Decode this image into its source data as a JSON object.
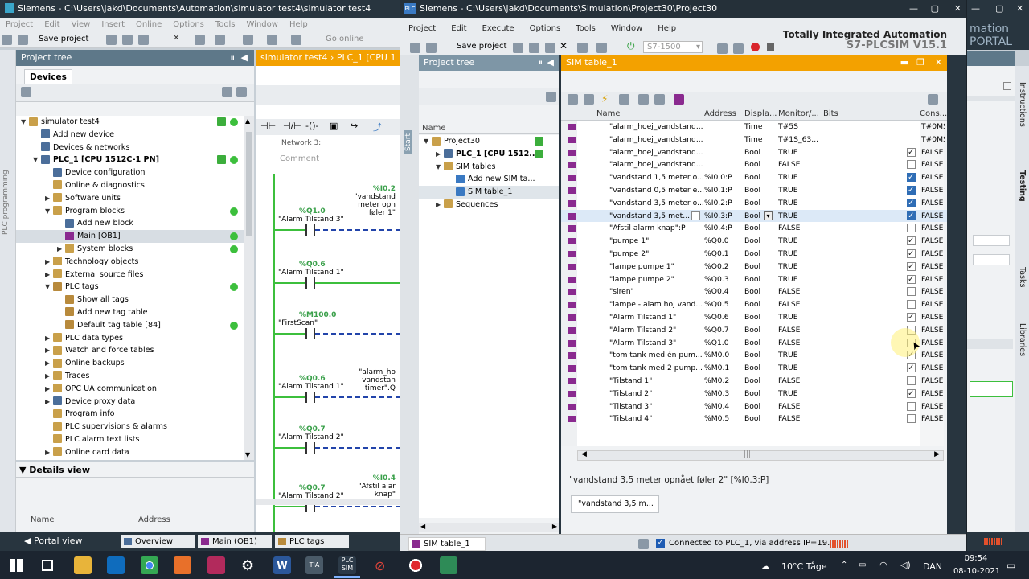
{
  "portal": {
    "title": "Siemens  -  C:\\Users\\jakd\\Documents\\Automation\\simulator test4\\simulator test4",
    "menu": [
      "Project",
      "Edit",
      "View",
      "Insert",
      "Online",
      "Options",
      "Tools",
      "Window",
      "Help"
    ],
    "save_label": "Save project",
    "go_online": "Go online",
    "right_brand": "mation",
    "right_brand2": "PORTAL",
    "project_tree_title": "Project tree",
    "devices_tab": "Devices",
    "side_label": "PLC programming",
    "tree": [
      {
        "label": "simulator test4",
        "indent": 0,
        "arrow": "▼"
      },
      {
        "label": "Add new device",
        "indent": 1,
        "arrow": ""
      },
      {
        "label": "Devices & networks",
        "indent": 1,
        "arrow": ""
      },
      {
        "label": "PLC_1 [CPU 1512C-1 PN]",
        "indent": 1,
        "arrow": "▼",
        "bold": true
      },
      {
        "label": "Device configuration",
        "indent": 2,
        "arrow": ""
      },
      {
        "label": "Online & diagnostics",
        "indent": 2,
        "arrow": ""
      },
      {
        "label": "Software units",
        "indent": 2,
        "arrow": "▶"
      },
      {
        "label": "Program blocks",
        "indent": 2,
        "arrow": "▼"
      },
      {
        "label": "Add new block",
        "indent": 3,
        "arrow": ""
      },
      {
        "label": "Main [OB1]",
        "indent": 3,
        "arrow": "",
        "selected": true
      },
      {
        "label": "System blocks",
        "indent": 3,
        "arrow": "▶"
      },
      {
        "label": "Technology objects",
        "indent": 2,
        "arrow": "▶"
      },
      {
        "label": "External source files",
        "indent": 2,
        "arrow": "▶"
      },
      {
        "label": "PLC tags",
        "indent": 2,
        "arrow": "▼"
      },
      {
        "label": "Show all tags",
        "indent": 3,
        "arrow": ""
      },
      {
        "label": "Add new tag table",
        "indent": 3,
        "arrow": ""
      },
      {
        "label": "Default tag table [84]",
        "indent": 3,
        "arrow": ""
      },
      {
        "label": "PLC data types",
        "indent": 2,
        "arrow": "▶"
      },
      {
        "label": "Watch and force tables",
        "indent": 2,
        "arrow": "▶"
      },
      {
        "label": "Online backups",
        "indent": 2,
        "arrow": "▶"
      },
      {
        "label": "Traces",
        "indent": 2,
        "arrow": "▶"
      },
      {
        "label": "OPC UA communication",
        "indent": 2,
        "arrow": "▶"
      },
      {
        "label": "Device proxy data",
        "indent": 2,
        "arrow": "▶"
      },
      {
        "label": "Program info",
        "indent": 2,
        "arrow": ""
      },
      {
        "label": "PLC supervisions & alarms",
        "indent": 2,
        "arrow": ""
      },
      {
        "label": "PLC alarm text lists",
        "indent": 2,
        "arrow": ""
      },
      {
        "label": "Online card data",
        "indent": 2,
        "arrow": "▶"
      }
    ],
    "details_view": "Details view",
    "details_cols": [
      "Name",
      "Address"
    ],
    "editor_tab": "simulator test4  ›  PLC_1 [CPU 1",
    "network_label": "Network 3:",
    "comment_label": "Comment",
    "ladder": [
      {
        "addr": "%Q1.0",
        "name": "\"Alarm Tilstand 3\""
      },
      {
        "addr": "%Q0.6",
        "name": "\"Alarm Tilstand 1\""
      },
      {
        "addr": "%M100.0",
        "name": "\"FirstScan\""
      },
      {
        "addr": "%Q0.6",
        "name": "\"Alarm Tilstand 1\""
      },
      {
        "addr": "%Q0.7",
        "name": "\"Alarm Tilstand 2\""
      },
      {
        "addr": "%Q0.7",
        "name": "\"Alarm Tilstand 2\""
      }
    ],
    "ladder_right": [
      {
        "addr": "%I0.2",
        "l1": "\"vandstand",
        "l2": "meter opn",
        "l3": "føler 1\""
      },
      {
        "addr": "",
        "l1": "\"alarm_ho",
        "l2": "vandstan",
        "l3": "timer\".Q"
      },
      {
        "addr": "%I0.4",
        "l1": "\"Afstil alar",
        "l2": "knap\"",
        "l3": ""
      }
    ],
    "portal_view": "Portal view",
    "bottom_tabs": [
      "Overview",
      "Main (OB1)",
      "PLC tags"
    ],
    "right_side_tabs": [
      "Instructions",
      "Testing",
      "Tasks",
      "Libraries"
    ]
  },
  "plcsim": {
    "title": "Siemens  -  C:\\Users\\jakd\\Documents\\Simulation\\Project30\\Project30",
    "menu": [
      "Project",
      "Edit",
      "Execute",
      "Options",
      "Tools",
      "Window",
      "Help"
    ],
    "save_label": "Save project",
    "cpu_select": "S7-1500",
    "brand1": "Totally Integrated Automation",
    "brand2": "S7-PLCSIM V15.1",
    "project_tree_title": "Project tree",
    "start_label": "Start",
    "tree_name_col": "Name",
    "tree": [
      {
        "label": "Project30",
        "indent": 0,
        "arrow": "▼"
      },
      {
        "label": "PLC_1 [CPU 1512...",
        "indent": 1,
        "arrow": "▶",
        "bold": true
      },
      {
        "label": "SIM tables",
        "indent": 1,
        "arrow": "▼"
      },
      {
        "label": "Add new SIM ta...",
        "indent": 2,
        "arrow": ""
      },
      {
        "label": "SIM table_1",
        "indent": 2,
        "arrow": "",
        "selected": true
      },
      {
        "label": "Sequences",
        "indent": 1,
        "arrow": "▶"
      }
    ],
    "sim_table_title": "SIM table_1",
    "columns": [
      "Name",
      "Address",
      "Displa...",
      "Monitor/...",
      "Bits",
      "Cons..."
    ],
    "rows": [
      {
        "name": "\"alarm_hoej_vandstand...",
        "addr": "",
        "disp": "Time",
        "mon": "T#5S",
        "bits": "",
        "cons": "T#0MS",
        "cb": ""
      },
      {
        "name": "\"alarm_hoej_vandstand...",
        "addr": "",
        "disp": "Time",
        "mon": "T#1S_63...",
        "bits": "",
        "cons": "T#0MS",
        "cb": ""
      },
      {
        "name": "\"alarm_hoej_vandstand...",
        "addr": "",
        "disp": "Bool",
        "mon": "TRUE",
        "bits": "",
        "cons": "FALSE",
        "cb": "on"
      },
      {
        "name": "\"alarm_hoej_vandstand...",
        "addr": "",
        "disp": "Bool",
        "mon": "FALSE",
        "bits": "",
        "cons": "FALSE",
        "cb": "off"
      },
      {
        "name": "\"vandstand 1,5 meter o...",
        "addr": "%I0.0:P",
        "disp": "Bool",
        "mon": "TRUE",
        "bits": "",
        "cons": "FALSE",
        "cb": "blue"
      },
      {
        "name": "\"vandstand 0,5 meter e...",
        "addr": "%I0.1:P",
        "disp": "Bool",
        "mon": "TRUE",
        "bits": "",
        "cons": "FALSE",
        "cb": "blue"
      },
      {
        "name": "\"vandstand 3,5 meter o...",
        "addr": "%I0.2:P",
        "disp": "Bool",
        "mon": "TRUE",
        "bits": "",
        "cons": "FALSE",
        "cb": "blue"
      },
      {
        "name": "\"vandstand 3,5 met...",
        "addr": "%I0.3:P",
        "disp": "Bool",
        "mon": "TRUE",
        "bits": "",
        "cons": "FALSE",
        "cb": "blue"
      },
      {
        "name": "\"Afstil alarm knap\":P",
        "addr": "%I0.4:P",
        "disp": "Bool",
        "mon": "FALSE",
        "bits": "",
        "cons": "FALSE",
        "cb": "off"
      },
      {
        "name": "\"pumpe 1\"",
        "addr": "%Q0.0",
        "disp": "Bool",
        "mon": "TRUE",
        "bits": "",
        "cons": "FALSE",
        "cb": "on"
      },
      {
        "name": "\"pumpe 2\"",
        "addr": "%Q0.1",
        "disp": "Bool",
        "mon": "TRUE",
        "bits": "",
        "cons": "FALSE",
        "cb": "on"
      },
      {
        "name": "\"lampe pumpe 1\"",
        "addr": "%Q0.2",
        "disp": "Bool",
        "mon": "TRUE",
        "bits": "",
        "cons": "FALSE",
        "cb": "on"
      },
      {
        "name": "\"lampe pumpe 2\"",
        "addr": "%Q0.3",
        "disp": "Bool",
        "mon": "TRUE",
        "bits": "",
        "cons": "FALSE",
        "cb": "on"
      },
      {
        "name": "\"siren\"",
        "addr": "%Q0.4",
        "disp": "Bool",
        "mon": "FALSE",
        "bits": "",
        "cons": "FALSE",
        "cb": "off"
      },
      {
        "name": "\"lampe - alam hoj vand...",
        "addr": "%Q0.5",
        "disp": "Bool",
        "mon": "FALSE",
        "bits": "",
        "cons": "FALSE",
        "cb": "off"
      },
      {
        "name": "\"Alarm Tilstand 1\"",
        "addr": "%Q0.6",
        "disp": "Bool",
        "mon": "TRUE",
        "bits": "",
        "cons": "FALSE",
        "cb": "on"
      },
      {
        "name": "\"Alarm Tilstand 2\"",
        "addr": "%Q0.7",
        "disp": "Bool",
        "mon": "FALSE",
        "bits": "",
        "cons": "FALSE",
        "cb": "off"
      },
      {
        "name": "\"Alarm Tilstand 3\"",
        "addr": "%Q1.0",
        "disp": "Bool",
        "mon": "FALSE",
        "bits": "",
        "cons": "FALSE",
        "cb": "off"
      },
      {
        "name": "\"tom tank med én pum...",
        "addr": "%M0.0",
        "disp": "Bool",
        "mon": "TRUE",
        "bits": "",
        "cons": "FALSE",
        "cb": "on"
      },
      {
        "name": "\"tom tank med 2 pump...",
        "addr": "%M0.1",
        "disp": "Bool",
        "mon": "TRUE",
        "bits": "",
        "cons": "FALSE",
        "cb": "on"
      },
      {
        "name": "\"Tilstand 1\"",
        "addr": "%M0.2",
        "disp": "Bool",
        "mon": "FALSE",
        "bits": "",
        "cons": "FALSE",
        "cb": "off"
      },
      {
        "name": "\"Tilstand 2\"",
        "addr": "%M0.3",
        "disp": "Bool",
        "mon": "TRUE",
        "bits": "",
        "cons": "FALSE",
        "cb": "on"
      },
      {
        "name": "\"Tilstand 3\"",
        "addr": "%M0.4",
        "disp": "Bool",
        "mon": "FALSE",
        "bits": "",
        "cons": "FALSE",
        "cb": "off"
      },
      {
        "name": "\"Tilstand 4\"",
        "addr": "%M0.5",
        "disp": "Bool",
        "mon": "FALSE",
        "bits": "",
        "cons": "FALSE",
        "cb": "off"
      }
    ],
    "info_text": "\"vandstand 3,5 meter opnået føler 2\" [%I0.3:P]",
    "info_button": "\"vandstand 3,5 m...",
    "bottom_tab": "SIM table_1",
    "status_text": "Connected to PLC_1, via address IP=19..."
  },
  "taskbar": {
    "weather": "10°C  Tåge",
    "lang": "DAN",
    "time": "09:54",
    "date": "08-10-2021"
  }
}
